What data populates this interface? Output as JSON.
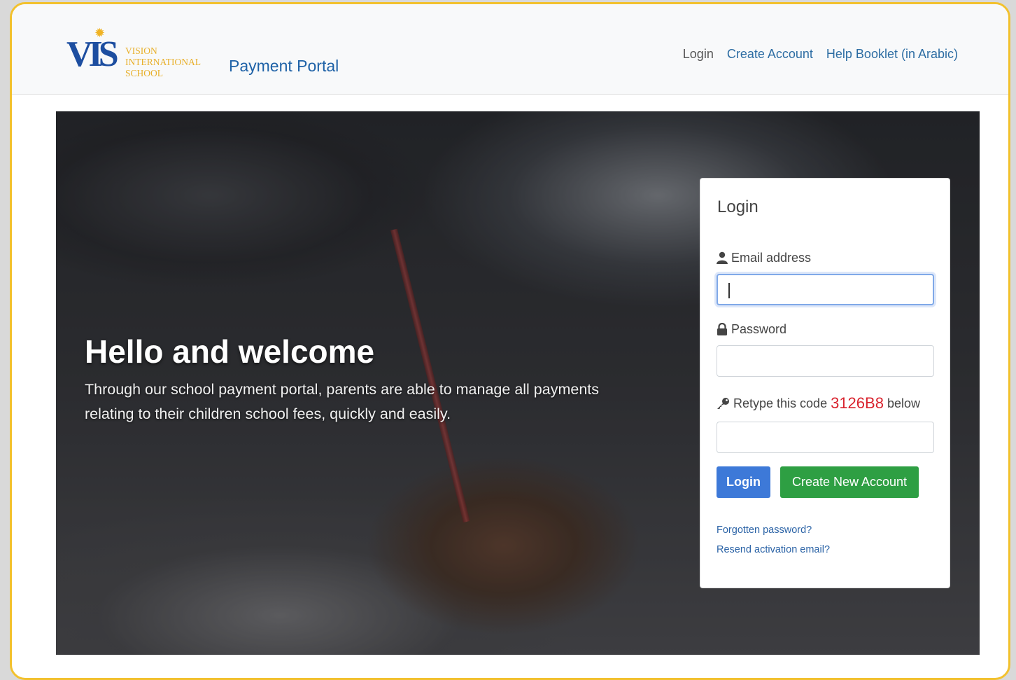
{
  "header": {
    "logo": {
      "monogram": "VIS",
      "lines": [
        "VISION",
        "INTERNATIONAL",
        "SCHOOL"
      ],
      "brand_color": "#1d4ea0",
      "accent_color": "#e8b02c"
    },
    "brand": "Payment Portal",
    "nav": [
      {
        "label": "Login",
        "active": true
      },
      {
        "label": "Create Account"
      },
      {
        "label": "Help Booklet (in Arabic)"
      }
    ]
  },
  "hero": {
    "title": "Hello and welcome",
    "text": "Through our school payment portal, parents are able to manage all payments relating to their children school fees, quickly and easily."
  },
  "login": {
    "title": "Login",
    "email": {
      "label": "Email address",
      "icon": "user-icon",
      "value": "",
      "placeholder": ""
    },
    "password": {
      "label": "Password",
      "icon": "lock-icon",
      "value": "",
      "placeholder": ""
    },
    "captcha": {
      "prefix": "Retype this code",
      "code": "3126B8",
      "suffix": "below",
      "icon": "key-icon",
      "value": ""
    },
    "login_button": "Login",
    "create_button": "Create New Account",
    "forgot_link": "Forgotten password?",
    "resend_link": "Resend activation email?"
  },
  "colors": {
    "frame_border": "#f2c12e",
    "login_button": "#3d79d8",
    "create_button": "#2e9f43",
    "captcha_code": "#d9232e",
    "link": "#2b63a6"
  }
}
